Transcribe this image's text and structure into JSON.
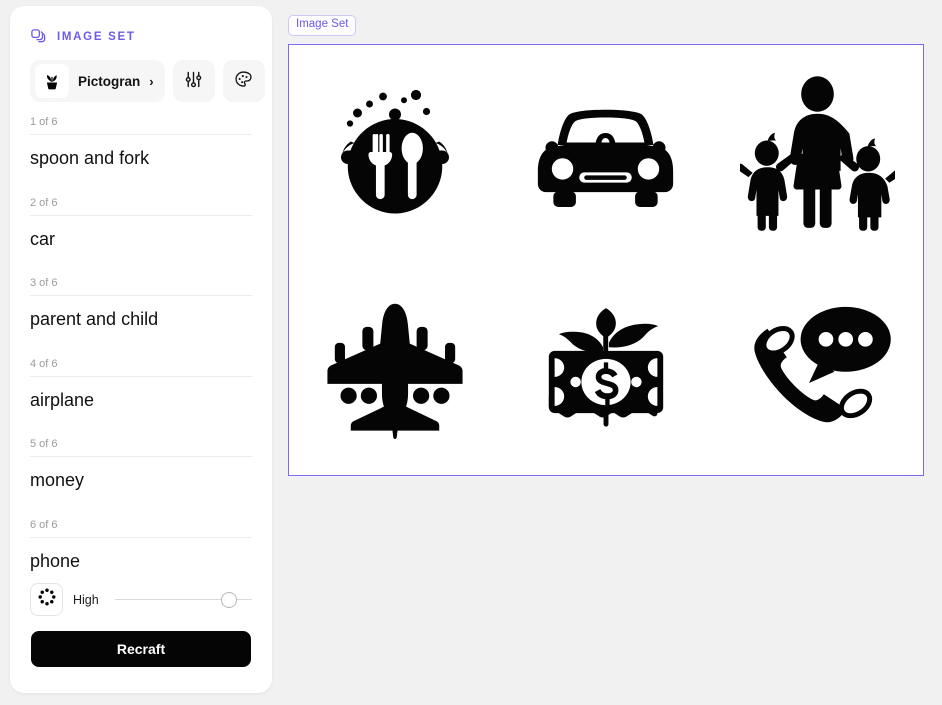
{
  "panel": {
    "icon": "stacked-layers-icon",
    "title": "IMAGE SET",
    "style_selector": {
      "thumb_icon": "potted-plant-icon",
      "label": "Pictogran",
      "chevron": "›"
    },
    "buttons": [
      {
        "name": "settings-sliders-button",
        "icon": "sliders-icon"
      },
      {
        "name": "palette-button",
        "icon": "palette-icon"
      }
    ]
  },
  "prompts": [
    {
      "count": "1 of 6",
      "text": "spoon and fork"
    },
    {
      "count": "2 of 6",
      "text": "car"
    },
    {
      "count": "3 of 6",
      "text": "parent and child"
    },
    {
      "count": "4 of 6",
      "text": "airplane"
    },
    {
      "count": "5 of 6",
      "text": "money"
    },
    {
      "count": "6 of 6",
      "text": "phone"
    }
  ],
  "quality": {
    "icon": "dot-ring-icon",
    "label": "High",
    "slider_value_percent": 83
  },
  "actions": {
    "recraft_label": "Recraft"
  },
  "canvas": {
    "badge_label": "Image Set",
    "images": [
      {
        "name": "pictogram-spoon-and-fork",
        "alt": "spoon and fork"
      },
      {
        "name": "pictogram-car",
        "alt": "car"
      },
      {
        "name": "pictogram-parent-and-child",
        "alt": "parent and child"
      },
      {
        "name": "pictogram-airplane",
        "alt": "airplane"
      },
      {
        "name": "pictogram-money",
        "alt": "money"
      },
      {
        "name": "pictogram-phone",
        "alt": "phone"
      }
    ]
  },
  "colors": {
    "accent": "#6c5ce7",
    "frame_border": "#7b6bf2",
    "page_background": "#f1f1f1",
    "pictogram": "#050505"
  }
}
